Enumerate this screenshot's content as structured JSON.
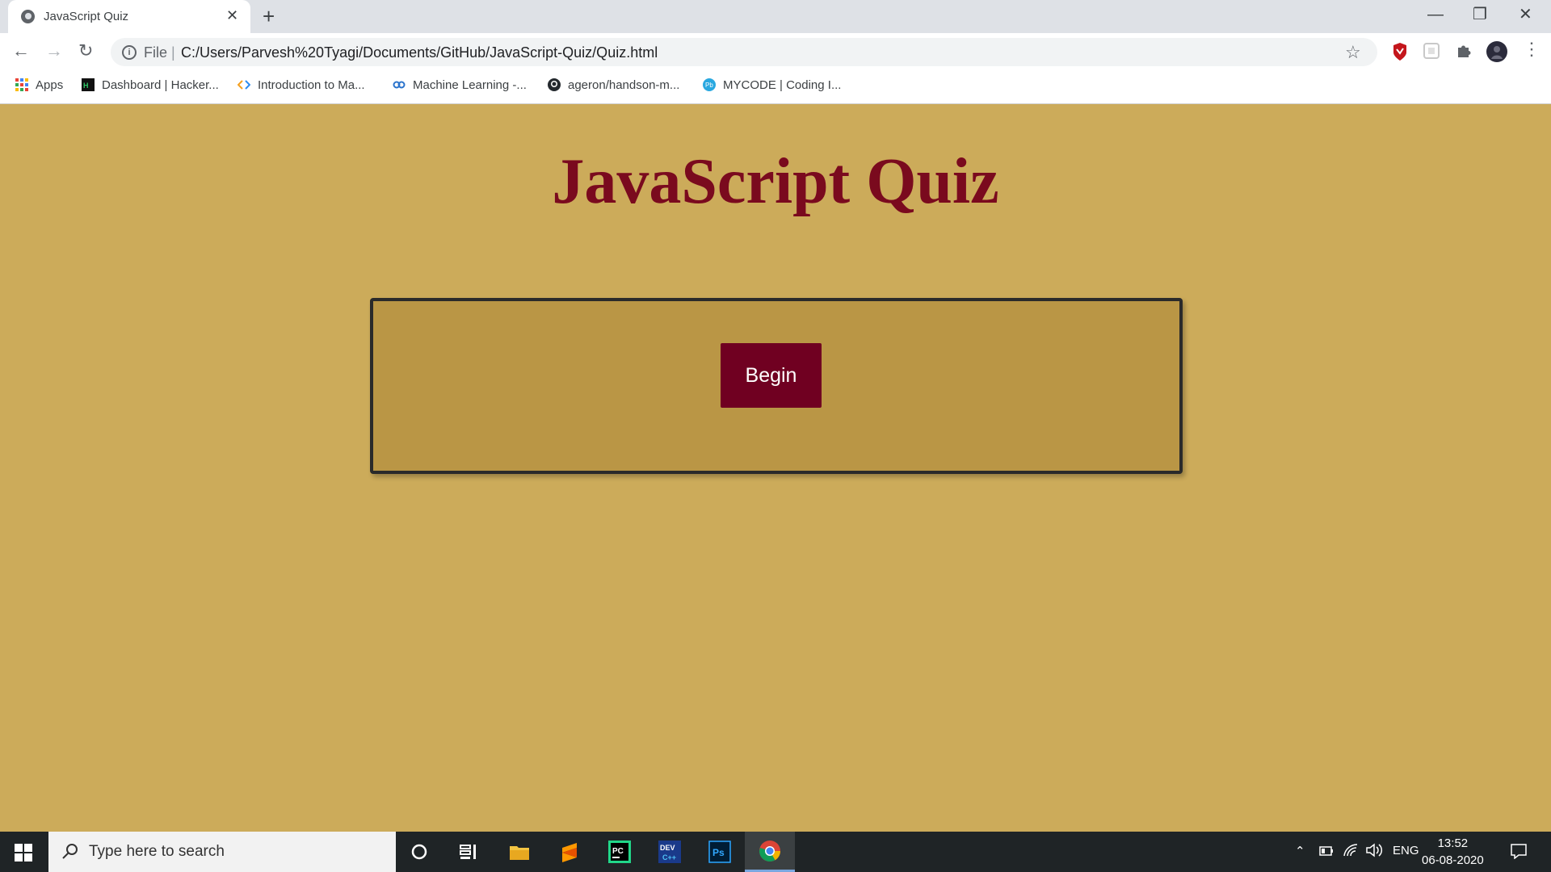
{
  "browser": {
    "tab_title": "JavaScript Quiz",
    "tab_close": "✕",
    "new_tab": "+",
    "window_minimize": "—",
    "window_restore": "❐",
    "window_close": "✕",
    "omnibox_scheme": "File",
    "omnibox_separator": "|",
    "url": "C:/Users/Parvesh%20Tyagi/Documents/GitHub/JavaScript-Quiz/Quiz.html",
    "bookmarks": [
      {
        "label": "Apps",
        "icon": "apps-grid-icon"
      },
      {
        "label": "Dashboard | Hacker...",
        "icon": "hackerrank-icon"
      },
      {
        "label": "Introduction to Ma...",
        "icon": "code-brackets-icon"
      },
      {
        "label": "Machine Learning -...",
        "icon": "coursera-icon"
      },
      {
        "label": "ageron/handson-m...",
        "icon": "github-icon"
      },
      {
        "label": "MYCODE | Coding I...",
        "icon": "mycode-icon"
      }
    ]
  },
  "page": {
    "title": "JavaScript Quiz",
    "begin_button": "Begin",
    "colors": {
      "background": "#ccab5a",
      "box": "#ba9645",
      "title": "#7a0a1e",
      "button": "#700021"
    }
  },
  "taskbar": {
    "search_placeholder": "Type here to search",
    "language": "ENG",
    "time": "13:52",
    "date": "06-08-2020"
  }
}
